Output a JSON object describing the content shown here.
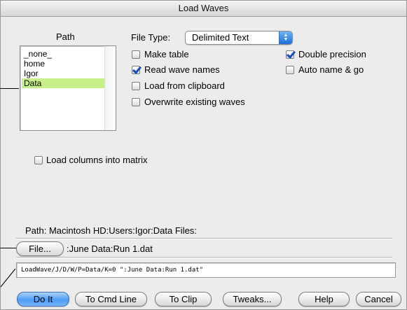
{
  "window": {
    "title": "Load Waves"
  },
  "path_panel": {
    "heading": "Path",
    "items": [
      {
        "label": "_none_",
        "selected": false
      },
      {
        "label": "home",
        "selected": false
      },
      {
        "label": "Igor",
        "selected": false
      },
      {
        "label": "Data",
        "selected": true
      }
    ]
  },
  "file_type": {
    "label": "File Type:",
    "selected": "Delimited Text"
  },
  "options": {
    "make_table": {
      "label": "Make table",
      "checked": false
    },
    "read_wave_names": {
      "label": "Read wave names",
      "checked": true
    },
    "load_from_clipboard": {
      "label": "Load from clipboard",
      "checked": false
    },
    "overwrite_existing_waves": {
      "label": "Overwrite existing waves",
      "checked": false
    },
    "double_precision": {
      "label": "Double precision",
      "checked": true
    },
    "auto_name_go": {
      "label": "Auto name & go",
      "checked": false
    },
    "load_columns_into_matrix": {
      "label": "Load columns into matrix",
      "checked": false
    }
  },
  "path_info": "Path:  Macintosh HD:Users:Igor:Data Files:",
  "file": {
    "button_label": "File...",
    "name": ":June Data:Run 1.dat"
  },
  "command": "LoadWave/J/D/W/P=Data/K=0 \":June Data:Run 1.dat\"",
  "buttons": {
    "do_it": "Do It",
    "to_cmd_line": "To Cmd Line",
    "to_clip": "To Clip",
    "tweaks": "Tweaks...",
    "help": "Help",
    "cancel": "Cancel"
  },
  "colors": {
    "selection": "#c8f08a",
    "default_button": "#4d9bf4",
    "checkmark": "#1a4fb8"
  }
}
